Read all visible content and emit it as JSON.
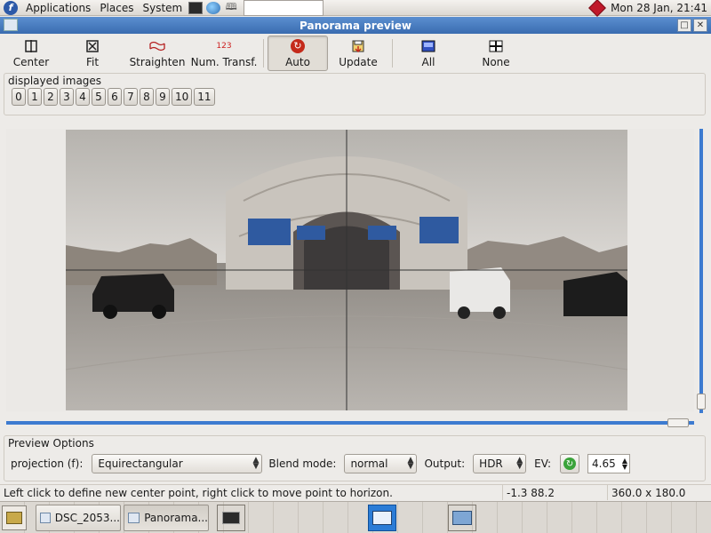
{
  "top_panel": {
    "menus": [
      "Applications",
      "Places",
      "System"
    ],
    "clock": "Mon 28 Jan, 21:41",
    "search_value": ""
  },
  "window": {
    "title": "Panorama preview"
  },
  "toolbar": {
    "center_label": "Center",
    "fit_label": "Fit",
    "straighten_label": "Straighten",
    "num_transf_label": "Num. Transf.",
    "num_transf_icon_text": "123",
    "auto_label": "Auto",
    "update_label": "Update",
    "all_label": "All",
    "none_label": "None"
  },
  "displayed_images": {
    "label": "displayed images",
    "buttons": [
      "0",
      "1",
      "2",
      "3",
      "4",
      "5",
      "6",
      "7",
      "8",
      "9",
      "10",
      "11"
    ]
  },
  "preview_options": {
    "label": "Preview Options",
    "projection_label": "projection (f):",
    "projection_value": "Equirectangular",
    "blend_label": "Blend mode:",
    "blend_value": "normal",
    "output_label": "Output:",
    "output_value": "HDR",
    "ev_label": "EV:",
    "ev_value": "4.65"
  },
  "statusbar": {
    "message": "Left click to define new center point, right click to move point to horizon.",
    "coords": "-1.3 88.2",
    "fov": "360.0 x 180.0"
  },
  "taskbar": {
    "tasks": [
      "DSC_2053...",
      "Panorama..."
    ]
  },
  "colors": {
    "titlebar": "#3a6cb0",
    "scrollbar_track": "#3d7bd0",
    "workspace_active": "#2b7cd6"
  }
}
